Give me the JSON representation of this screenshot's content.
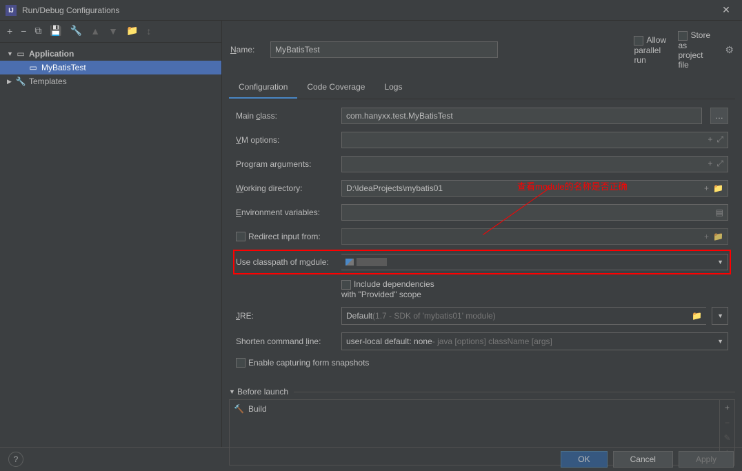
{
  "window": {
    "title": "Run/Debug Configurations"
  },
  "tree": {
    "root1": "Application",
    "child1": "MyBatisTest",
    "root2": "Templates"
  },
  "nameRow": {
    "label": "Name:",
    "value": "MyBatisTest",
    "allowParallel": "Allow parallel run",
    "storeProject": "Store as project file"
  },
  "tabs": {
    "config": "Configuration",
    "cover": "Code Coverage",
    "logs": "Logs"
  },
  "form": {
    "mainClass": {
      "label": "Main class:",
      "value": "com.hanyxx.test.MyBatisTest"
    },
    "vmOptions": {
      "label": "VM options:"
    },
    "programArgs": {
      "label": "Program arguments:"
    },
    "workingDir": {
      "label": "Working directory:",
      "value": "D:\\IdeaProjects\\mybatis01"
    },
    "envVars": {
      "label": "Environment variables:"
    },
    "redirect": {
      "label": " Redirect input from:"
    },
    "classpath": {
      "label": "Use classpath of module:"
    },
    "includeProvided": "Include dependencies with \"Provided\" scope",
    "jre": {
      "label": "JRE:",
      "value": "Default",
      "detail": " (1.7 - SDK of 'mybatis01' module)"
    },
    "shorten": {
      "label": "Shorten command line:",
      "value": "user-local default: none",
      "detail": " - java [options] className [args]"
    },
    "snapshots": "Enable capturing form snapshots"
  },
  "beforeLaunch": {
    "title": "Before launch",
    "build": "Build"
  },
  "buttons": {
    "ok": "OK",
    "cancel": "Cancel",
    "apply": "Apply"
  },
  "annotation": "查看module的名称是否正确"
}
